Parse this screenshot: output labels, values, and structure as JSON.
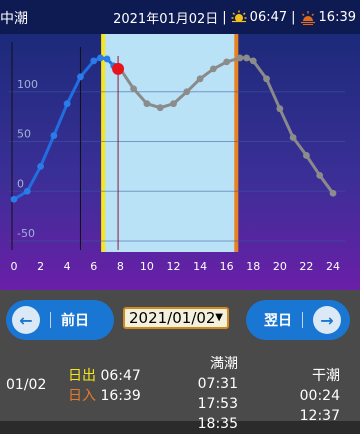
{
  "header": {
    "title": "中潮",
    "date": "2021年01月02日",
    "sunrise": "06:47",
    "sunset": "16:39",
    "separator": "|"
  },
  "chart_data": {
    "type": "line",
    "x_ticks": [
      "0",
      "2",
      "4",
      "6",
      "8",
      "10",
      "12",
      "14",
      "16",
      "18",
      "20",
      "22",
      "24"
    ],
    "y_ticks": [
      "100",
      "50",
      "0",
      "-50"
    ],
    "xlim": [
      0,
      24
    ],
    "ylim": [
      -55,
      150
    ],
    "daylight_start": 6.78,
    "daylight_end": 16.65,
    "current_hour": 7.83,
    "x": [
      0,
      1,
      2,
      3,
      4,
      5,
      6,
      6.5,
      7,
      7.5,
      8,
      9,
      10,
      11,
      12,
      13,
      14,
      15,
      16,
      17,
      17.5,
      18,
      19,
      20,
      21,
      22,
      23,
      24
    ],
    "y": [
      -8,
      0,
      25,
      56,
      88,
      115,
      131,
      134,
      133,
      126,
      123,
      103,
      88,
      84,
      88,
      100,
      113,
      123,
      130,
      134,
      134,
      131,
      113,
      83,
      54,
      36,
      16,
      -2
    ],
    "colors": {
      "past_line": "#1f6fe0",
      "future_line": "#8a8a8a",
      "daylight": "#b9e2f6",
      "sunrise_bar": "#f7e61b",
      "sunset_bar": "#e8821e",
      "current_point": "#e8141c"
    }
  },
  "controls": {
    "prev_label": "前日",
    "next_label": "翌日",
    "date_value": "2021/01/02"
  },
  "info": {
    "date": "01/02",
    "sunrise_label": "日出",
    "sunrise_time": "06:47",
    "sunset_label": "日入",
    "sunset_time": "16:39",
    "high_label": "満潮",
    "high_times": [
      "07:31",
      "17:53",
      "18:35"
    ],
    "low_label": "干潮",
    "low_times": [
      "00:24",
      "12:37"
    ]
  }
}
